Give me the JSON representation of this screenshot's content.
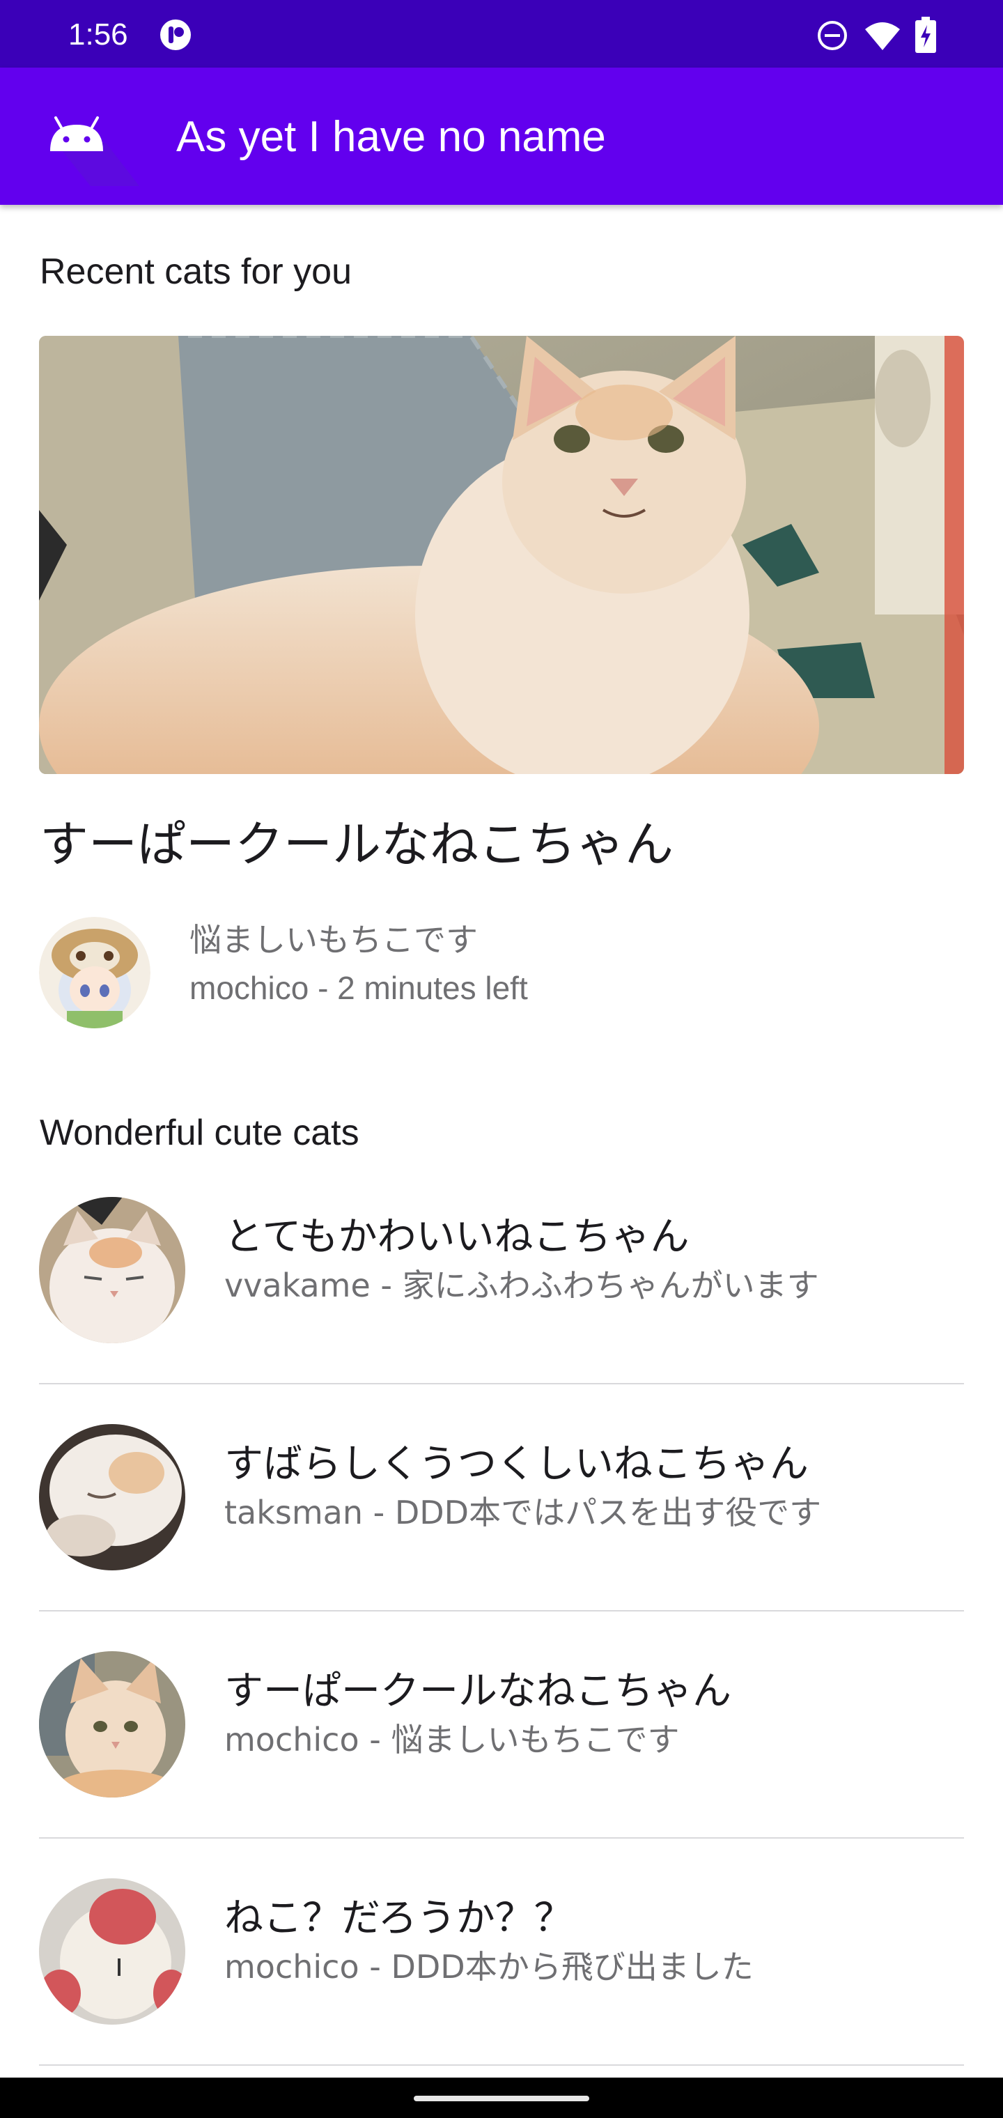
{
  "status_bar": {
    "time": "1:56",
    "icons": [
      "app-notification-icon",
      "do-not-disturb-icon",
      "wifi-icon",
      "battery-charging-icon"
    ]
  },
  "app_bar": {
    "title": "As yet I have no name",
    "logo_icon": "android-icon",
    "background_color": "#6200ee"
  },
  "recent": {
    "section_title": "Recent cats for you",
    "card": {
      "image": "cat-photo",
      "title": "すーぱークールなねこちゃん",
      "description": "悩ましいもちこです",
      "meta": "mochico - 2 minutes left"
    }
  },
  "wonderful": {
    "section_title": "Wonderful cute cats",
    "items": [
      {
        "title": "とてもかわいいねこちゃん",
        "subtitle": "vvakame - 家にふわふわちゃんがいます"
      },
      {
        "title": "すばらしくうつくしいねこちゃん",
        "subtitle": "taksman - DDD本ではパスを出す役です"
      },
      {
        "title": "すーぱークールなねこちゃん",
        "subtitle": "mochico - 悩ましいもちこです"
      },
      {
        "title": "ねこ？だろうか？？",
        "subtitle": "mochico - DDD本から飛び出ました"
      }
    ]
  },
  "colors": {
    "status_bar": "#3b00b8",
    "primary": "#6200ee",
    "secondary_text": "#6f6f72"
  }
}
